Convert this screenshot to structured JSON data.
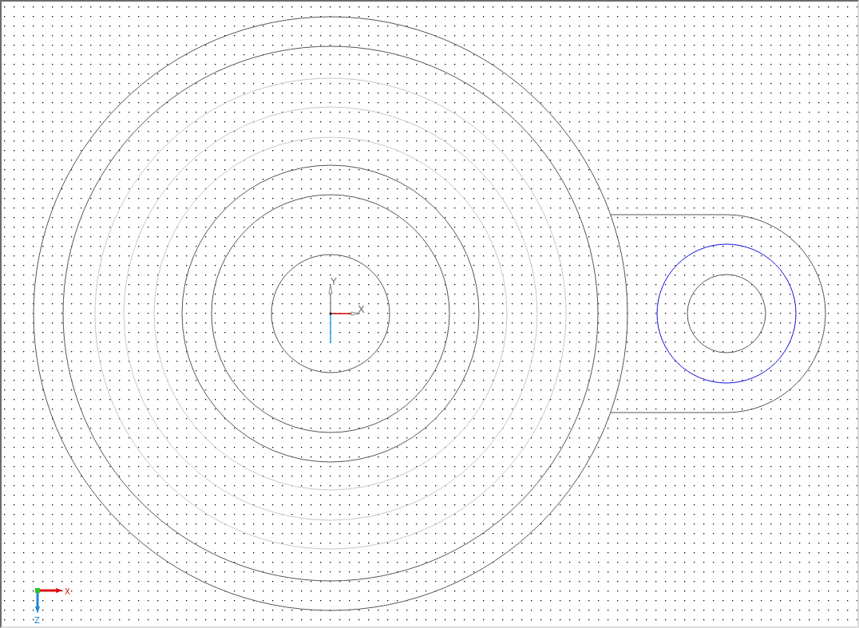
{
  "viewport": {
    "origin_axes": {
      "x_label": "X",
      "y_label": "Y"
    },
    "view_triad": {
      "x_label": "X",
      "z_label": "Z"
    }
  }
}
